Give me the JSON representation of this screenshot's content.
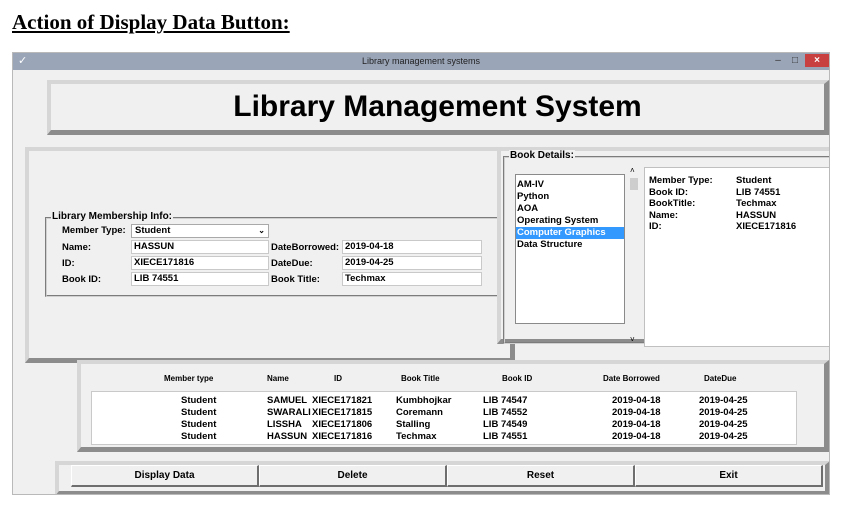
{
  "document_heading": "Action of Display Data Button:",
  "window": {
    "title": "Library management systems",
    "controls": {
      "minimize": "–",
      "maximize": "□",
      "close": "×"
    }
  },
  "header": {
    "title": "Library Management System"
  },
  "membership": {
    "group_label": "Library Membership Info:",
    "member_type_label": "Member Type:",
    "member_type_value": "Student",
    "name_label": "Name:",
    "name_value": "HASSUN",
    "id_label": "ID:",
    "id_value": "XIECE171816",
    "book_id_label": "Book ID:",
    "book_id_value": "LIB 74551",
    "date_borrowed_label": "DateBorrowed:",
    "date_borrowed_value": "2019-04-18",
    "date_due_label": "DateDue:",
    "date_due_value": "2019-04-25",
    "book_title_label": "Book Title:",
    "book_title_value": "Techmax"
  },
  "book_details": {
    "group_label": "Book Details:",
    "books": [
      "AM-IV",
      "Python",
      "AOA",
      "Operating System",
      "Computer Graphics",
      "Data Structure"
    ],
    "selected_index": 4,
    "detail": {
      "member_type_label": "Member Type:",
      "member_type_value": "Student",
      "book_id_label": "Book ID:",
      "book_id_value": "LIB 74551",
      "book_title_label": "BookTitle:",
      "book_title_value": "Techmax",
      "name_label": "Name:",
      "name_value": "HASSUN",
      "id_label": "ID:",
      "id_value": "XIECE171816"
    }
  },
  "records": {
    "headers": [
      "Member type",
      "Name",
      "ID",
      "Book Title",
      "Book ID",
      "Date Borrowed",
      "DateDue"
    ],
    "rows": [
      {
        "member_type": "Student",
        "name": "SAMUEL",
        "id": "XIECE171821",
        "book_title": "Kumbhojkar",
        "book_id": "LIB 74547",
        "date_borrowed": "2019-04-18",
        "date_due": "2019-04-25"
      },
      {
        "member_type": "Student",
        "name": "SWARALI",
        "id": "XIECE171815",
        "book_title": "Coremann",
        "book_id": "LIB 74552",
        "date_borrowed": "2019-04-18",
        "date_due": "2019-04-25"
      },
      {
        "member_type": "Student",
        "name": "LISSHA",
        "id": "XIECE171806",
        "book_title": "Stalling",
        "book_id": "LIB 74549",
        "date_borrowed": "2019-04-18",
        "date_due": "2019-04-25"
      },
      {
        "member_type": "Student",
        "name": "HASSUN",
        "id": "XIECE171816",
        "book_title": "Techmax",
        "book_id": "LIB 74551",
        "date_borrowed": "2019-04-18",
        "date_due": "2019-04-25"
      }
    ]
  },
  "buttons": {
    "display": "Display Data",
    "delete": "Delete",
    "reset": "Reset",
    "exit": "Exit"
  }
}
